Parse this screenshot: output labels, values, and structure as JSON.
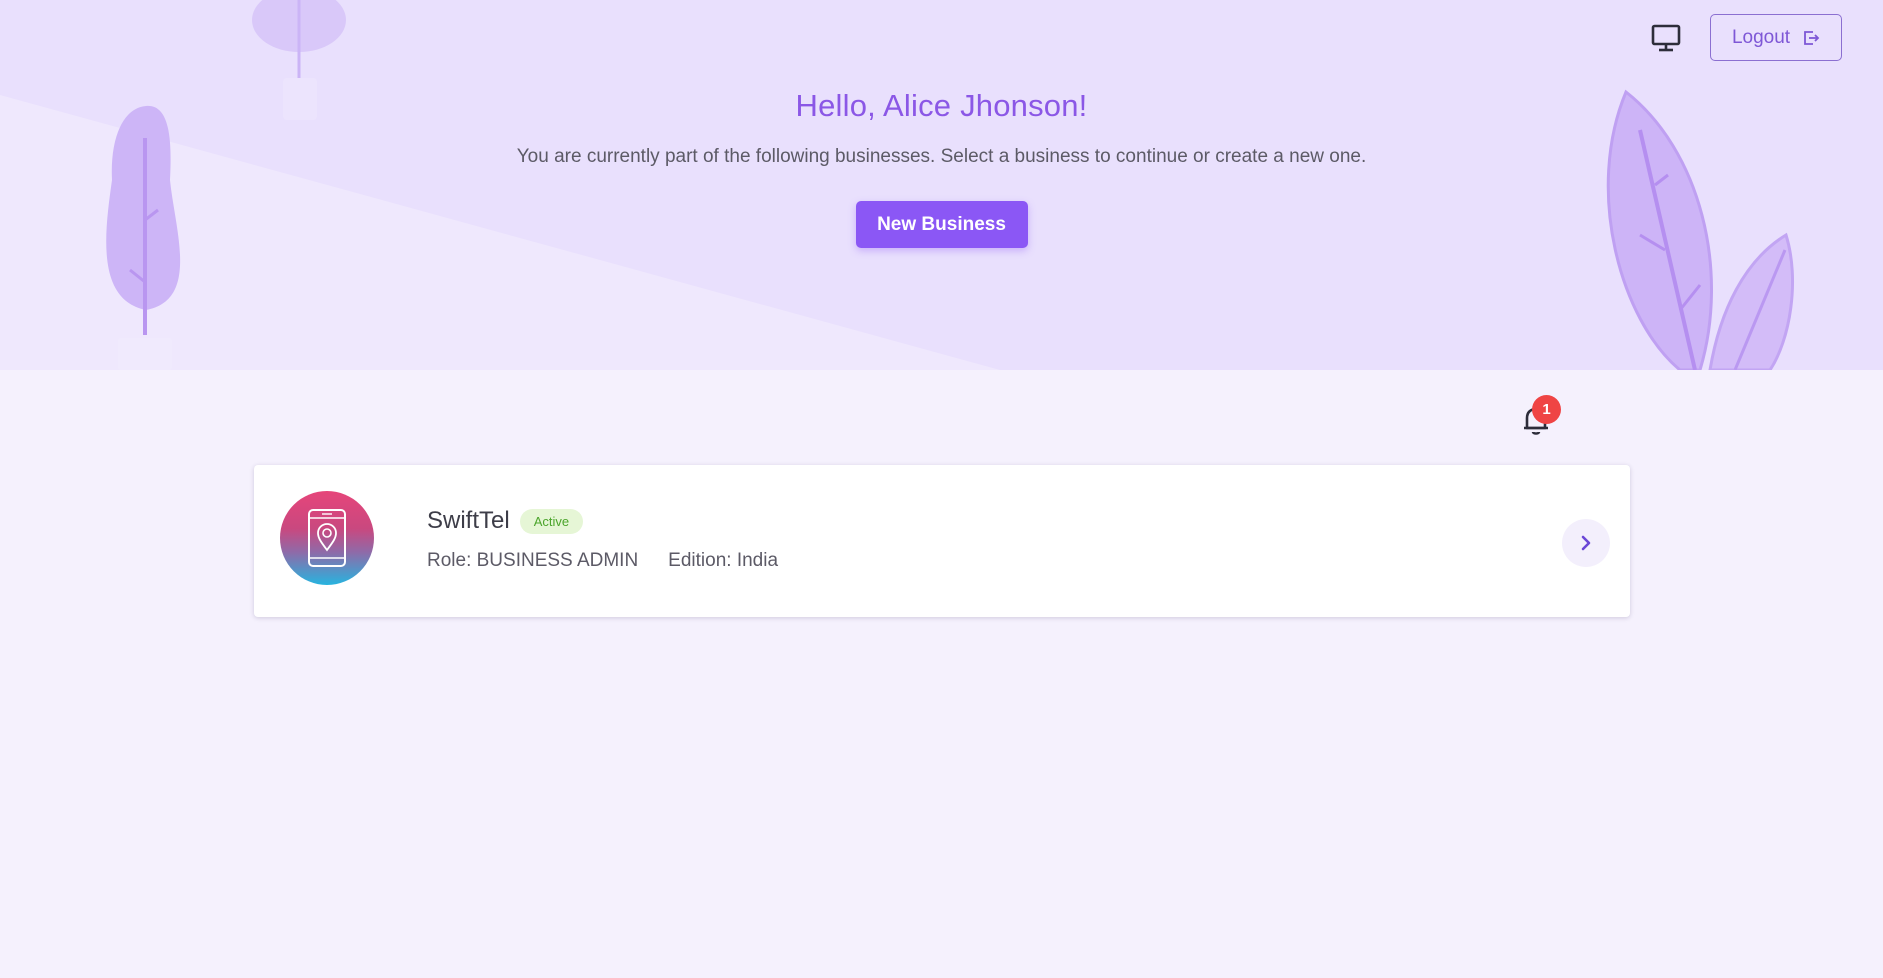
{
  "hero": {
    "greeting": "Hello, Alice Jhonson!",
    "subtitle": "You are currently part of the following businesses. Select a business to continue or create a new one.",
    "new_business_label": "New Business"
  },
  "header": {
    "monitor_icon": "monitor-icon",
    "logout_label": "Logout",
    "logout_icon": "logout-icon"
  },
  "notifications": {
    "count": "1",
    "icon": "bell-icon"
  },
  "businesses": [
    {
      "name": "SwiftTel",
      "status": "Active",
      "role": "Role: BUSINESS ADMIN",
      "edition": "Edition: India",
      "logo_icon": "phone-location-icon"
    }
  ],
  "colors": {
    "accent": "#8b57f5",
    "hero_bg": "#e9e0fd",
    "page_bg": "#f5f1fd",
    "status_active": "#4ca52c",
    "badge_red": "#ef4444"
  }
}
